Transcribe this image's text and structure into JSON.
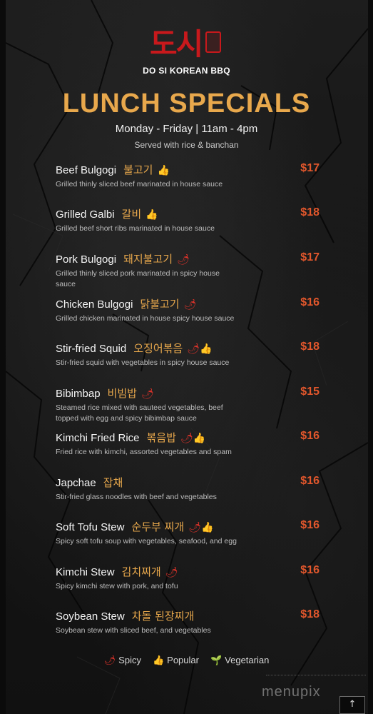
{
  "logo": {
    "korean": "도시",
    "seal": "도시 코리안"
  },
  "brand": "DO SI KOREAN BBQ",
  "title": "LUNCH SPECIALS",
  "hours": "Monday - Friday | 11am - 4pm",
  "served": "Served with rice & banchan",
  "items": [
    {
      "name": "Beef Bulgogi",
      "korean": "불고기",
      "tags": [
        "popular"
      ],
      "desc": "Grilled thinly sliced beef marinated in house sauce",
      "price": "$17"
    },
    {
      "name": "Grilled Galbi",
      "korean": "갈비",
      "tags": [
        "popular"
      ],
      "desc": "Grilled beef short ribs marinated in house sauce",
      "price": "$18"
    },
    {
      "name": "Pork Bulgogi",
      "korean": "돼지불고기",
      "tags": [
        "spicy"
      ],
      "desc": "Grilled thinly sliced pork marinated in spicy house sauce",
      "price": "$17"
    },
    {
      "name": "Chicken Bulgogi",
      "korean": "닭불고기",
      "tags": [
        "spicy"
      ],
      "desc": "Grilled chicken marinated in house spicy house sauce",
      "price": "$16"
    },
    {
      "name": "Stir-fried Squid",
      "korean": "오징어볶음",
      "tags": [
        "spicy",
        "popular"
      ],
      "desc": "Stir-fried squid with vegetables in spicy house sauce",
      "price": "$18"
    },
    {
      "name": "Bibimbap",
      "korean": "비빔밥",
      "tags": [
        "spicy"
      ],
      "desc": "Steamed rice mixed with sauteed vegetables, beef topped with egg and spicy bibimbap sauce",
      "price": "$15"
    },
    {
      "name": "Kimchi Fried Rice",
      "korean": "볶음밥",
      "tags": [
        "spicy",
        "popular"
      ],
      "desc": "Fried rice with kimchi, assorted vegetables and spam",
      "price": "$16"
    },
    {
      "name": "Japchae",
      "korean": "잡채",
      "tags": [],
      "desc": "Stir-fried glass noodles with beef and vegetables",
      "price": "$16"
    },
    {
      "name": "Soft Tofu Stew",
      "korean": "순두부 찌개",
      "tags": [
        "spicy",
        "popular"
      ],
      "desc": "Spicy soft tofu soup with vegetables, seafood, and egg",
      "price": "$16"
    },
    {
      "name": "Kimchi Stew",
      "korean": "김치찌개",
      "tags": [
        "spicy"
      ],
      "desc": "Spicy kimchi stew with pork, and tofu",
      "price": "$16"
    },
    {
      "name": "Soybean Stew",
      "korean": "차돌 된장찌개",
      "tags": [],
      "desc": "Soybean stew with sliced beef, and vegetables",
      "price": "$18"
    }
  ],
  "legend": [
    {
      "icon": "chili-icon",
      "label": "Spicy"
    },
    {
      "icon": "thumbs-up-icon",
      "label": "Popular"
    },
    {
      "icon": "sprout-icon",
      "label": "Vegetarian"
    }
  ],
  "watermark": "menupix",
  "colors": {
    "accent": "#e8a84c",
    "price": "#e2572c",
    "logo": "#c8191c"
  }
}
